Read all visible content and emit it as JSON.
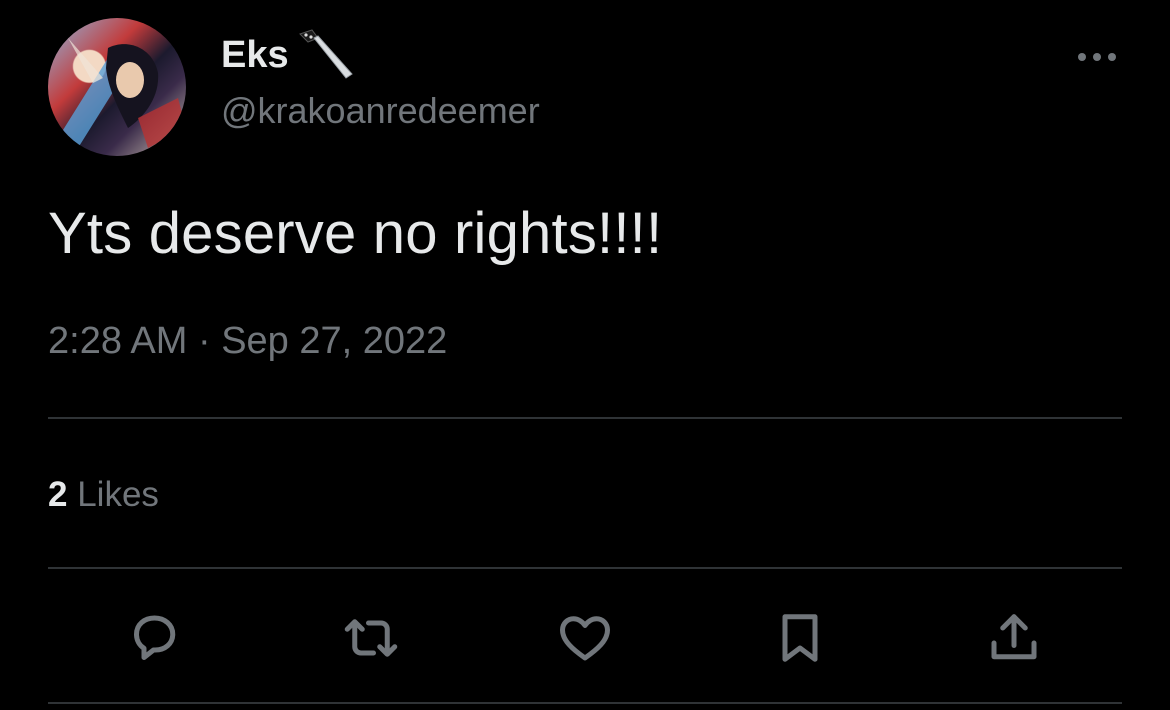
{
  "tweet": {
    "author": {
      "display_name": "Eks",
      "name_emoji": "knife-icon",
      "handle": "@krakoanredeemer"
    },
    "text": "Yts deserve no rights!!!!",
    "time": "2:28 AM",
    "separator": "·",
    "date": "Sep 27, 2022",
    "likes": {
      "count": "2",
      "label": "Likes"
    }
  },
  "actions": [
    {
      "name": "reply",
      "icon": "reply-icon"
    },
    {
      "name": "retweet",
      "icon": "retweet-icon"
    },
    {
      "name": "like",
      "icon": "heart-icon"
    },
    {
      "name": "bookmark",
      "icon": "bookmark-icon"
    },
    {
      "name": "share",
      "icon": "share-icon"
    }
  ],
  "colors": {
    "background": "#000000",
    "primary_text": "#e7e9ea",
    "secondary_text": "#71767b",
    "divider": "#2f3336"
  }
}
